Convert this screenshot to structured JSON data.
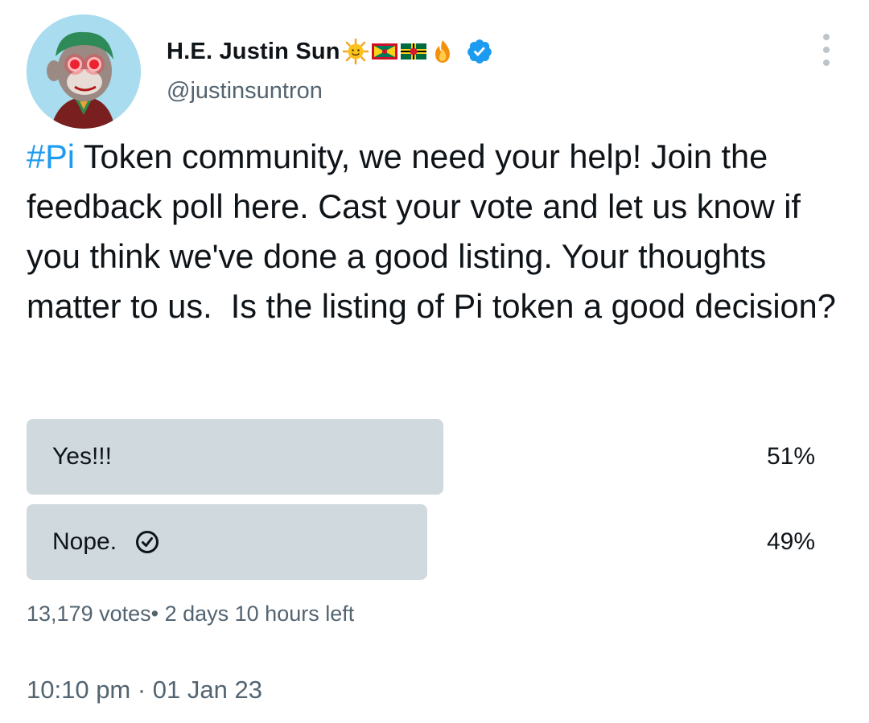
{
  "author": {
    "display_name": "H.E. Justin Sun",
    "handle": "@justinsuntron",
    "name_emojis": [
      "sun-emoji",
      "grenada-flag-emoji",
      "dominica-flag-emoji",
      "fire-emoji"
    ],
    "verified": true
  },
  "tweet": {
    "hashtag": "#Pi",
    "text": " Token community, we need your help! Join the feedback poll here. Cast your vote and let us know if you think we've done a good listing. Your thoughts matter to us.  Is the listing of Pi token a good decision?"
  },
  "poll": {
    "options": [
      {
        "label": "Yes!!!",
        "percent_text": "51%",
        "percent": 51,
        "voted": false
      },
      {
        "label": "Nope.",
        "percent_text": "49%",
        "percent": 49,
        "voted": true
      }
    ],
    "votes": "13,179 votes",
    "separator": "•",
    "time_left": "2 days 10 hours left"
  },
  "timestamp": "10:10 pm · 01 Jan 23",
  "colors": {
    "hashtag": "#1d9bf0",
    "verified": "#1d9bf0",
    "poll_bar": "#cfd9de",
    "secondary_text": "#536471"
  }
}
